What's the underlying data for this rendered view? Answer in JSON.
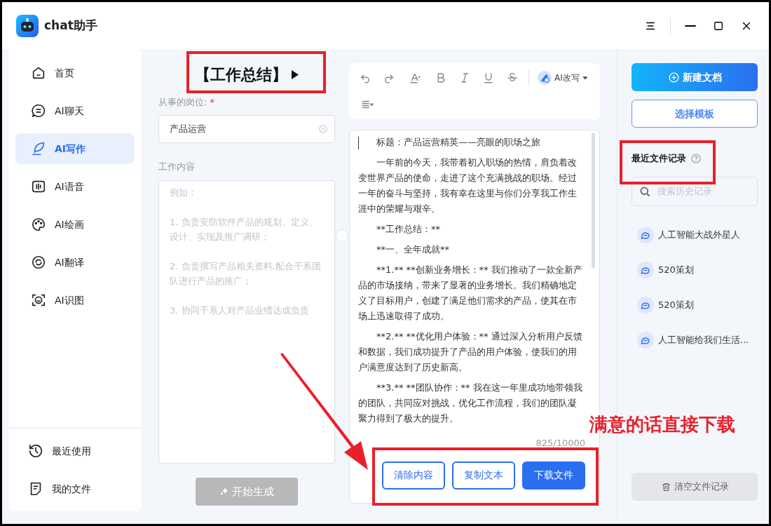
{
  "window": {
    "title": "chat助手"
  },
  "sidebar": {
    "items": [
      {
        "label": "首页",
        "selected": false
      },
      {
        "label": "AI聊天",
        "selected": false
      },
      {
        "label": "AI写作",
        "selected": true
      },
      {
        "label": "AI语音",
        "selected": false
      },
      {
        "label": "AI绘画",
        "selected": false
      },
      {
        "label": "AI翻译",
        "selected": false
      },
      {
        "label": "AI识图",
        "selected": false
      }
    ],
    "footer_items": [
      {
        "label": "最近使用"
      },
      {
        "label": "我的文件"
      }
    ]
  },
  "form": {
    "title": "【工作总结】",
    "position_label": "从事的岗位:",
    "required_mark": "*",
    "position_value": "产品运营",
    "content_label": "工作内容",
    "content_placeholder": "例如：\n\n1. 负责安防软件产品的规划、定义、设计、实现及推广调研；\n\n2. 负责撰写产品相关资料,配合干系团队进行产品的推广；\n\n3. 协同干系人对产品业绩达成负责",
    "generate_button": {
      "label": "开始生成",
      "disabled": true
    }
  },
  "editor": {
    "toolbar": {
      "ai_rewrite": "AI改写"
    },
    "paragraphs": [
      "标题：产品运营精英——亮眼的职场之旅",
      "一年前的今天，我带着初入职场的热情，肩负着改变世界产品的使命，走进了这个充满挑战的职场。经过一年的奋斗与坚持，我有幸在这里与你们分享我工作生涯中的荣耀与艰辛。",
      "**工作总结：**",
      "**一、全年成就**",
      "**1.** **创新业务增长：** 我们推动了一款全新产品的市场接纳，带来了显著的业务增长。我们精确地定义了目标用户，创建了满足他们需求的产品，使其在市场上迅速取得了成功。",
      "**2.** **优化用户体验：** 通过深入分析用户反馈和数据，我们成功提升了产品的用户体验，使我们的用户满意度达到了历史新高。",
      "**3.** **团队协作：** 我在这一年里成功地带领我的团队，共同应对挑战，优化工作流程，我们的团队凝聚力得到了极大的提升。"
    ],
    "counter": "825/10000",
    "buttons": [
      {
        "label": "清除内容",
        "kind": "outline"
      },
      {
        "label": "复制文本",
        "kind": "outline"
      },
      {
        "label": "下载文件",
        "kind": "primary"
      }
    ]
  },
  "right_panel": {
    "new_doc_button": "新建文档",
    "template_button": "选择模板",
    "recent_heading": "最近文件记录",
    "search_placeholder": "搜索历史记录",
    "recent_files": [
      {
        "label": "人工智能大战外星人"
      },
      {
        "label": "520策划"
      },
      {
        "label": "520策划"
      },
      {
        "label": "人工智能给我们生活..."
      }
    ],
    "clear_button": "清空文件记录"
  },
  "annotations": {
    "callout": "满意的话直接下载"
  }
}
